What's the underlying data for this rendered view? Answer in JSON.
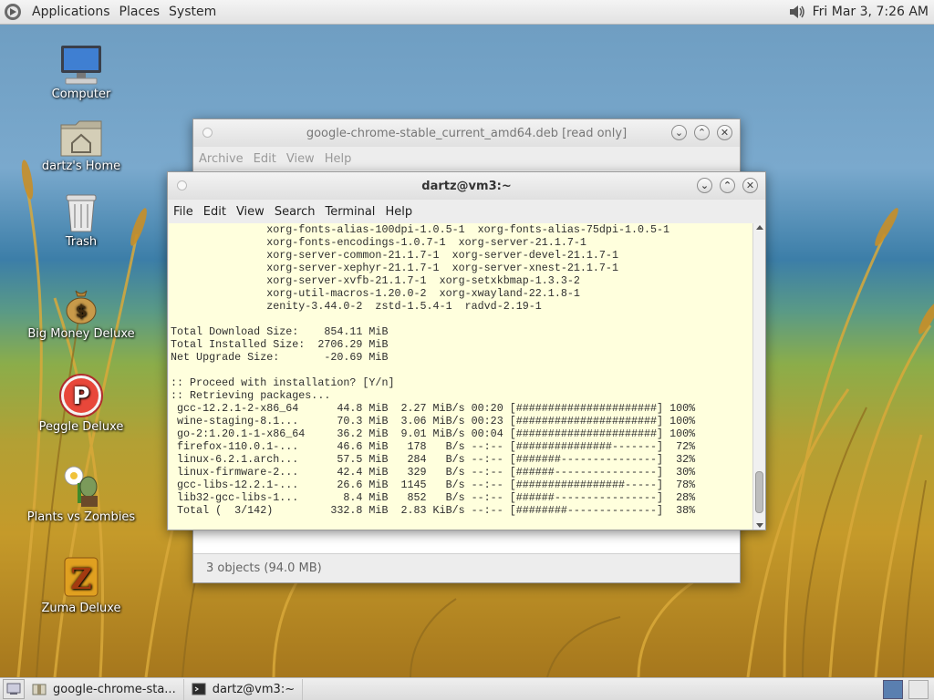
{
  "top_panel": {
    "menus": [
      "Applications",
      "Places",
      "System"
    ],
    "clock": "Fri Mar  3,  7:26 AM"
  },
  "desktop_icons": [
    {
      "label": "Computer"
    },
    {
      "label": "dartz's Home"
    },
    {
      "label": "Trash"
    },
    {
      "label": "Big Money Deluxe"
    },
    {
      "label": "Peggle Deluxe"
    },
    {
      "label": "Plants vs Zombies"
    },
    {
      "label": "Zuma Deluxe"
    }
  ],
  "archive_window": {
    "title": "google-chrome-stable_current_amd64.deb [read only]",
    "menu": [
      "Archive",
      "Edit",
      "View",
      "Help"
    ],
    "status": "3 objects (94.0 MB)"
  },
  "terminal_window": {
    "title": "dartz@vm3:~",
    "menu": [
      "File",
      "Edit",
      "View",
      "Search",
      "Terminal",
      "Help"
    ],
    "lines": [
      "               xorg-fonts-alias-100dpi-1.0.5-1  xorg-fonts-alias-75dpi-1.0.5-1",
      "               xorg-fonts-encodings-1.0.7-1  xorg-server-21.1.7-1",
      "               xorg-server-common-21.1.7-1  xorg-server-devel-21.1.7-1",
      "               xorg-server-xephyr-21.1.7-1  xorg-server-xnest-21.1.7-1",
      "               xorg-server-xvfb-21.1.7-1  xorg-setxkbmap-1.3.3-2",
      "               xorg-util-macros-1.20.0-2  xorg-xwayland-22.1.8-1",
      "               zenity-3.44.0-2  zstd-1.5.4-1  radvd-2.19-1",
      "",
      "Total Download Size:    854.11 MiB",
      "Total Installed Size:  2706.29 MiB",
      "Net Upgrade Size:       -20.69 MiB",
      "",
      ":: Proceed with installation? [Y/n]",
      ":: Retrieving packages...",
      " gcc-12.2.1-2-x86_64      44.8 MiB  2.27 MiB/s 00:20 [######################] 100%",
      " wine-staging-8.1...      70.3 MiB  3.06 MiB/s 00:23 [######################] 100%",
      " go-2:1.20.1-1-x86_64     36.2 MiB  9.01 MiB/s 00:04 [######################] 100%",
      " firefox-110.0.1-...      46.6 MiB   178   B/s --:-- [###############-------]  72%",
      " linux-6.2.1.arch...      57.5 MiB   284   B/s --:-- [#######---------------]  32%",
      " linux-firmware-2...      42.4 MiB   329   B/s --:-- [######----------------]  30%",
      " gcc-libs-12.2.1-...      26.6 MiB  1145   B/s --:-- [#################-----]  78%",
      " lib32-gcc-libs-1...       8.4 MiB   852   B/s --:-- [######----------------]  28%",
      " Total (  3/142)         332.8 MiB  2.83 KiB/s --:-- [########--------------]  38%"
    ]
  },
  "taskbar": {
    "tasks": [
      "google-chrome-sta...",
      "dartz@vm3:~"
    ]
  }
}
